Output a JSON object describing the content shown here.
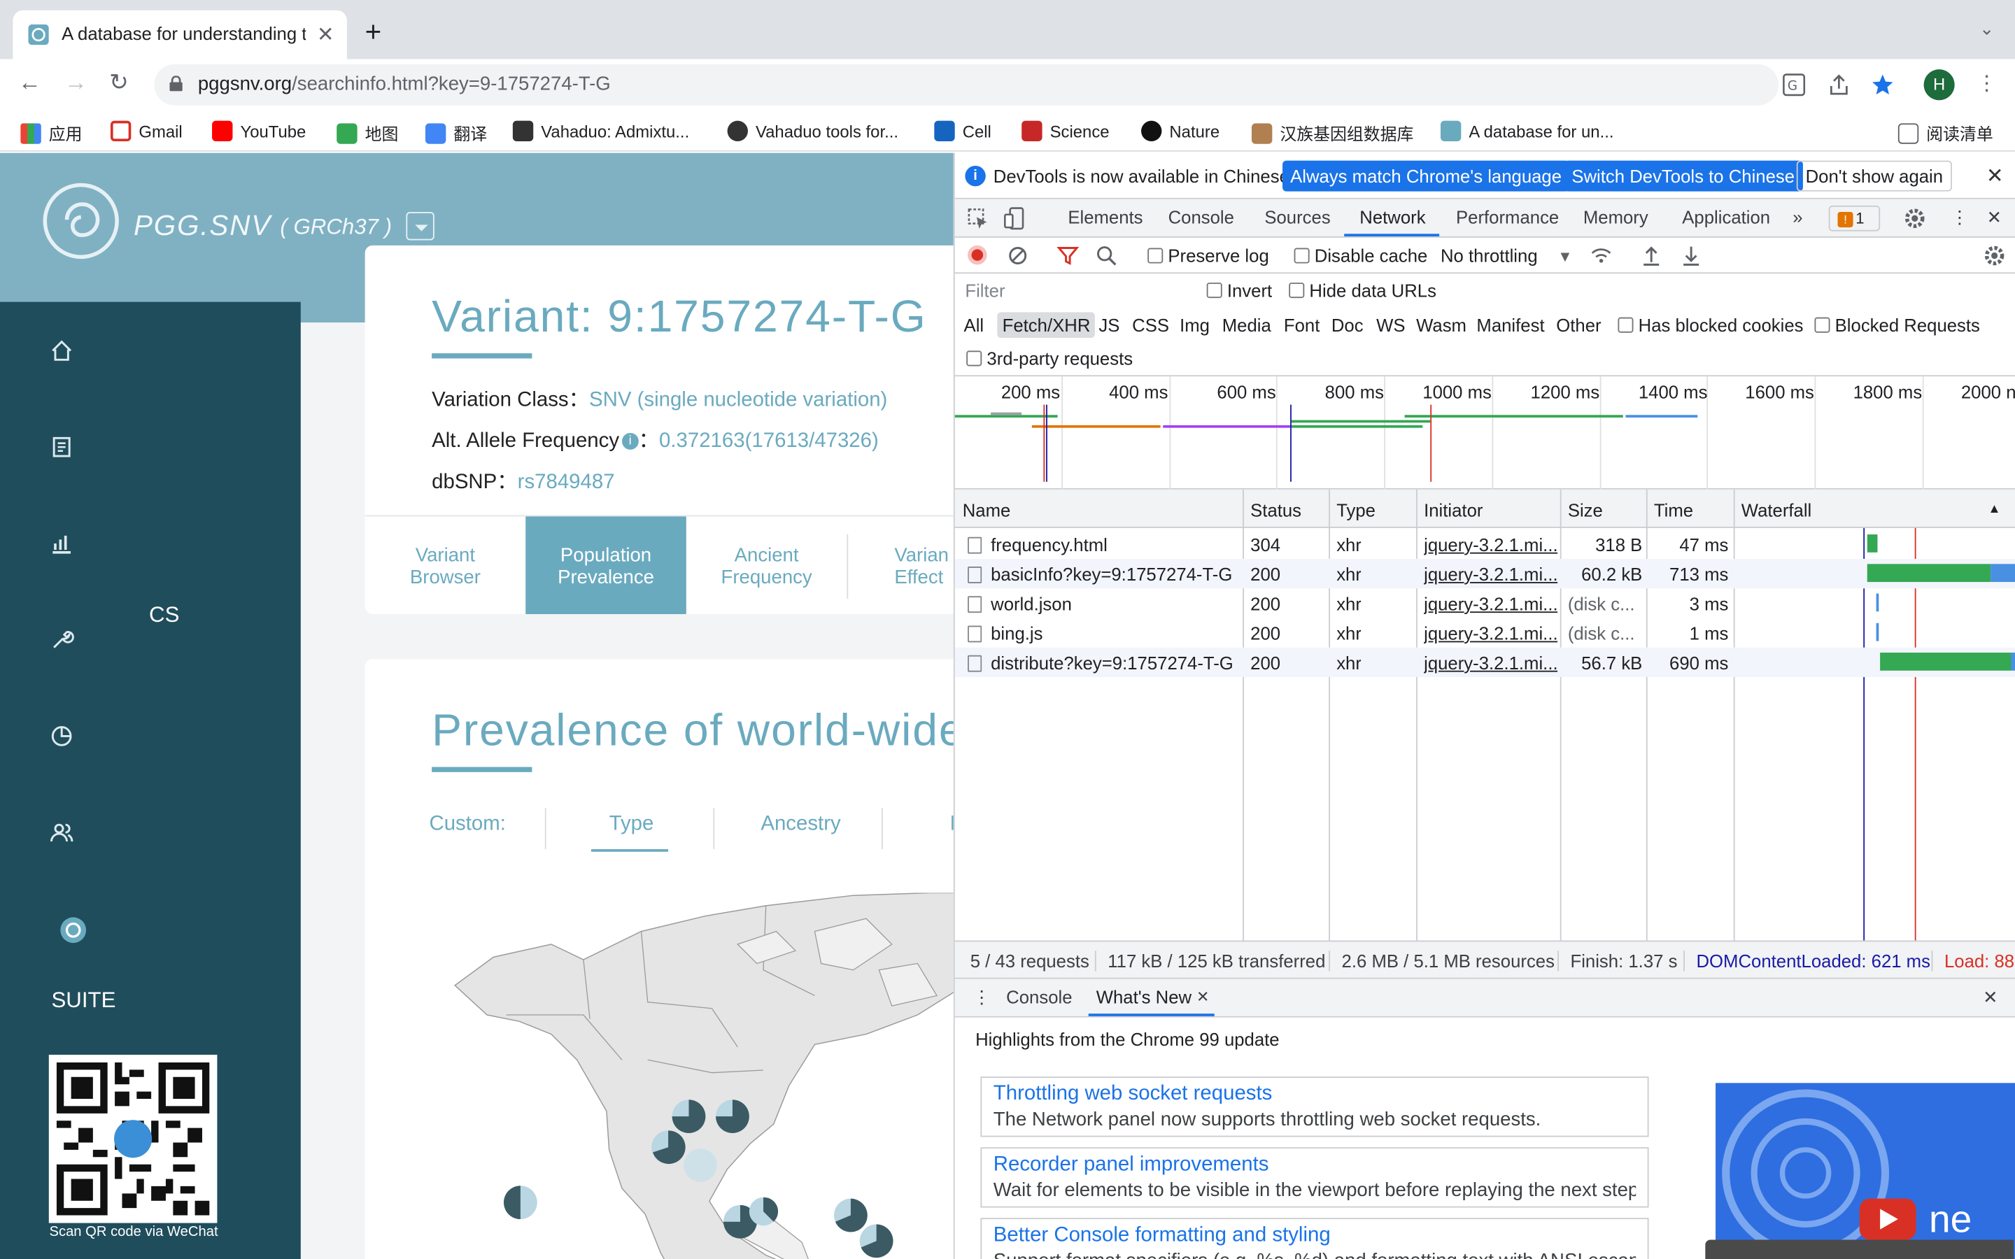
{
  "browser": {
    "tab_title": "A database for understanding the",
    "url_host": "pggsnv.org",
    "url_path": "/searchinfo.html?key=9-1757274-T-G",
    "avatar_letter": "H"
  },
  "bookmarks": [
    {
      "label": "应用",
      "color": "#ea4335"
    },
    {
      "label": "Gmail",
      "color": "#d93025"
    },
    {
      "label": "YouTube",
      "color": "#ff0000"
    },
    {
      "label": "地图",
      "color": "#34a853"
    },
    {
      "label": "翻译",
      "color": "#4285f4"
    },
    {
      "label": "Vahaduo: Admixtu...",
      "color": "#333333"
    },
    {
      "label": "Vahaduo tools for...",
      "color": "#333333"
    },
    {
      "label": "Cell",
      "color": "#1565c0"
    },
    {
      "label": "Science",
      "color": "#c62828"
    },
    {
      "label": "Nature",
      "color": "#111111"
    },
    {
      "label": "汉族基因组数据库",
      "color": "#b08050"
    },
    {
      "label": "A database for un...",
      "color": "#6aaabf"
    }
  ],
  "reading_list": "阅读清单",
  "site": {
    "logo": "PGG.SNV",
    "assembly": "( GRCh37 )",
    "sidebar_partial": "CS",
    "sidebar_suite": "SUITE",
    "qr_caption": "Scan QR code via WeChat",
    "variant_title": "Variant: 9:1757274-T-G",
    "variation_class_label": "Variation Class：",
    "variation_class_value": "SNV (single nucleotide variation)",
    "alt_freq_label": "Alt. Allele Frequency",
    "alt_freq_colon": "：",
    "alt_freq_value": "0.372163(17613/47326)",
    "dbsnp_label": "dbSNP：",
    "dbsnp_value": "rs7849487",
    "tabs": [
      {
        "line1": "Variant",
        "line2": "Browser"
      },
      {
        "line1": "Population",
        "line2": "Prevalence"
      },
      {
        "line1": "Ancient",
        "line2": "Frequency"
      },
      {
        "line1": "Varian",
        "line2": "Effect"
      }
    ],
    "prevalence_title": "Prevalence of world-wide p",
    "custom_label": "Custom:",
    "custom_tabs": [
      "Type",
      "Ancestry",
      "I"
    ]
  },
  "devtools": {
    "infobar_msg": "DevTools is now available in Chinese!",
    "btn_match": "Always match Chrome's language",
    "btn_switch": "Switch DevTools to Chinese",
    "btn_dont": "Don't show again",
    "tabs": [
      "Elements",
      "Console",
      "Sources",
      "Network",
      "Performance",
      "Memory",
      "Application"
    ],
    "issues_count": "1",
    "preserve_log": "Preserve log",
    "disable_cache": "Disable cache",
    "throttling": "No throttling",
    "filter_placeholder": "Filter",
    "invert": "Invert",
    "hide_data_urls": "Hide data URLs",
    "types": [
      "All",
      "Fetch/XHR",
      "JS",
      "CSS",
      "Img",
      "Media",
      "Font",
      "Doc",
      "WS",
      "Wasm",
      "Manifest",
      "Other"
    ],
    "has_blocked_cookies": "Has blocked cookies",
    "blocked_requests": "Blocked Requests",
    "third_party": "3rd-party requests",
    "timeline_labels": [
      "200 ms",
      "400 ms",
      "600 ms",
      "800 ms",
      "1000 ms",
      "1200 ms",
      "1400 ms",
      "1600 ms",
      "1800 ms",
      "2000 n"
    ],
    "columns": [
      "Name",
      "Status",
      "Type",
      "Initiator",
      "Size",
      "Time",
      "Waterfall"
    ],
    "requests": [
      {
        "name": "frequency.html",
        "status": "304",
        "type": "xhr",
        "initiator": "jquery-3.2.1.mi...",
        "size": "318 B",
        "time": "47 ms"
      },
      {
        "name": "basicInfo?key=9:1757274-T-G",
        "status": "200",
        "type": "xhr",
        "initiator": "jquery-3.2.1.mi...",
        "size": "60.2 kB",
        "time": "713 ms"
      },
      {
        "name": "world.json",
        "status": "200",
        "type": "xhr",
        "initiator": "jquery-3.2.1.mi...",
        "size": "(disk c...",
        "time": "3 ms"
      },
      {
        "name": "bing.js",
        "status": "200",
        "type": "xhr",
        "initiator": "jquery-3.2.1.mi...",
        "size": "(disk c...",
        "time": "1 ms"
      },
      {
        "name": "distribute?key=9:1757274-T-G",
        "status": "200",
        "type": "xhr",
        "initiator": "jquery-3.2.1.mi...",
        "size": "56.7 kB",
        "time": "690 ms"
      }
    ],
    "summary": {
      "requests": "5 / 43 requests",
      "transferred": "117 kB / 125 kB transferred",
      "resources": "2.6 MB / 5.1 MB resources",
      "finish": "Finish: 1.37 s",
      "dcl": "DOMContentLoaded: 621 ms",
      "load": "Load: 88"
    },
    "drawer_tabs": [
      "Console",
      "What's New"
    ],
    "highlights": "Highlights from the Chrome 99 update",
    "whats_new": [
      {
        "title": "Throttling web socket requests",
        "desc": "The Network panel now supports throttling web socket requests."
      },
      {
        "title": "Recorder panel improvements",
        "desc": "Wait for elements to be visible in the viewport before replaying the next step"
      },
      {
        "title": "Better Console formatting and styling",
        "desc": "Support format specifiers (e.g. %s, %d) and formatting text with ANSI escape in"
      }
    ],
    "promo_text": "ne"
  },
  "colors": {
    "accent": "#6aaabf",
    "sidebar": "#1f4d5c",
    "devtools_blue": "#1a73e8",
    "waterfall_green": "#34a853"
  }
}
